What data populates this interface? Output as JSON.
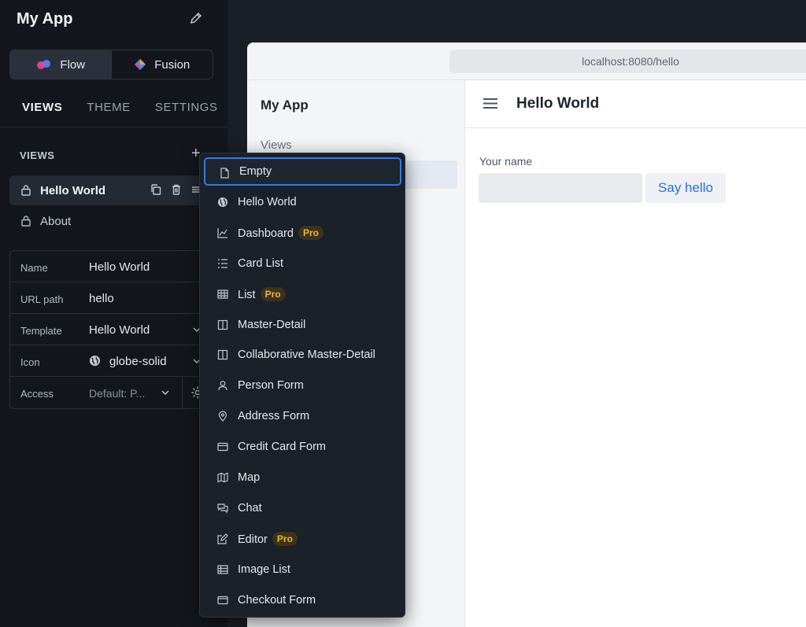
{
  "app_title": "My App",
  "segments": [
    {
      "label": "Flow",
      "active": true
    },
    {
      "label": "Fusion",
      "active": false
    }
  ],
  "tabs": [
    "VIEWS",
    "THEME",
    "SETTINGS"
  ],
  "views_header": "VIEWS",
  "views": [
    {
      "label": "Hello World",
      "selected": true
    },
    {
      "label": "About",
      "selected": false
    }
  ],
  "properties": {
    "name": {
      "key": "Name",
      "value": "Hello World"
    },
    "url_path": {
      "key": "URL path",
      "value": "hello"
    },
    "template": {
      "key": "Template",
      "value": "Hello World"
    },
    "icon": {
      "key": "Icon",
      "value": "globe-solid"
    },
    "access": {
      "key": "Access",
      "value": "Default: P..."
    }
  },
  "browser": {
    "url": "localhost:8080/hello",
    "drawer_title": "My App",
    "drawer_section": "Views",
    "page_title": "Hello World",
    "field_label": "Your name",
    "button_label": "Say hello"
  },
  "template_menu": {
    "pro_badge": "Pro",
    "items": [
      {
        "label": "Empty",
        "icon": "file-icon"
      },
      {
        "label": "Hello World",
        "icon": "globe-icon"
      },
      {
        "label": "Dashboard",
        "icon": "chart-icon",
        "pro": true
      },
      {
        "label": "Card List",
        "icon": "list-icon"
      },
      {
        "label": "List",
        "icon": "grid-icon",
        "pro": true
      },
      {
        "label": "Master-Detail",
        "icon": "columns-icon"
      },
      {
        "label": "Collaborative Master-Detail",
        "icon": "columns-icon"
      },
      {
        "label": "Person Form",
        "icon": "user-icon"
      },
      {
        "label": "Address Form",
        "icon": "map-pin-icon"
      },
      {
        "label": "Credit Card Form",
        "icon": "credit-card-icon"
      },
      {
        "label": "Map",
        "icon": "map-icon"
      },
      {
        "label": "Chat",
        "icon": "chat-icon"
      },
      {
        "label": "Editor",
        "icon": "edit-icon",
        "pro": true
      },
      {
        "label": "Image List",
        "icon": "image-list-icon"
      },
      {
        "label": "Checkout Form",
        "icon": "checkout-icon"
      }
    ]
  },
  "colors": {
    "accent": "#3a78d8",
    "pro_badge": "#f2b530",
    "panel_bg": "#13171d",
    "link_blue": "#2c6fd8"
  }
}
